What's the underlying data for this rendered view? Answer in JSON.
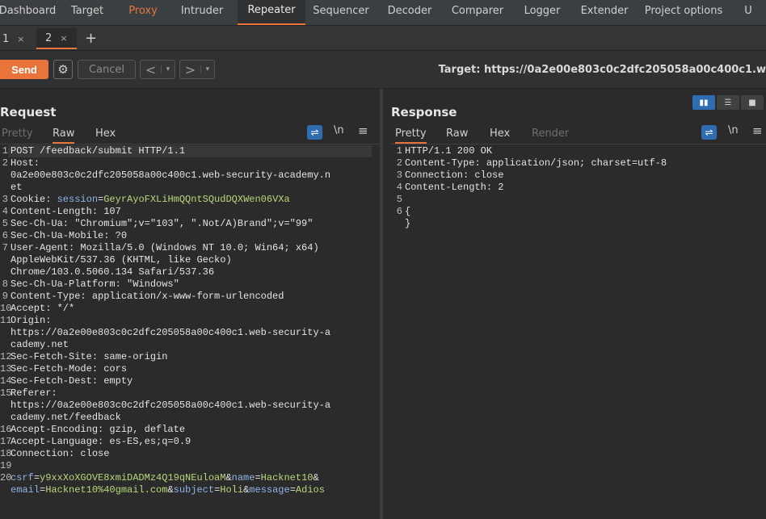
{
  "nav": {
    "tabs": [
      "Dashboard",
      "Target",
      "Proxy",
      "Intruder",
      "Repeater",
      "Sequencer",
      "Decoder",
      "Comparer",
      "Logger",
      "Extender",
      "Project options",
      "U"
    ]
  },
  "subtabs": [
    {
      "label": "1",
      "close": "×"
    },
    {
      "label": "2",
      "close": "×"
    }
  ],
  "add_tab": "+",
  "toolbar": {
    "send_label": "Send",
    "cancel_label": "Cancel",
    "prev_arrow": "<",
    "next_arrow": ">",
    "dropdown": "▾",
    "target": "Target: https://0a2e00e803c0c2dfc205058a00c400c1.w"
  },
  "request": {
    "title": "Request",
    "tabs": [
      "Pretty",
      "Raw",
      "Hex"
    ],
    "active_tab": "Raw",
    "newline_icon": "\\n",
    "lines": [
      {
        "n": "1",
        "parts": [
          [
            "k",
            "POST /feedback/submit HTTP/1.1"
          ]
        ]
      },
      {
        "n": "2",
        "parts": [
          [
            "k",
            "Host: "
          ]
        ]
      },
      {
        "n": "",
        "parts": [
          [
            "k",
            "0a2e00e803c0c2dfc205058a00c400c1.web-security-academy.n"
          ]
        ]
      },
      {
        "n": "",
        "parts": [
          [
            "k",
            "et"
          ]
        ]
      },
      {
        "n": "3",
        "parts": [
          [
            "k",
            "Cookie: "
          ],
          [
            "cv",
            "session"
          ],
          [
            "k",
            "="
          ],
          [
            "gv",
            "GeyrAyoFXLiHmQQntSQudDQXWen06VXa"
          ]
        ]
      },
      {
        "n": "4",
        "parts": [
          [
            "k",
            "Content-Length: 107"
          ]
        ]
      },
      {
        "n": "5",
        "parts": [
          [
            "k",
            "Sec-Ch-Ua: \"Chromium\";v=\"103\", \".Not/A)Brand\";v=\"99\""
          ]
        ]
      },
      {
        "n": "6",
        "parts": [
          [
            "k",
            "Sec-Ch-Ua-Mobile: ?0"
          ]
        ]
      },
      {
        "n": "7",
        "parts": [
          [
            "k",
            "User-Agent: Mozilla/5.0 (Windows NT 10.0; Win64; x64)"
          ]
        ]
      },
      {
        "n": "",
        "parts": [
          [
            "k",
            "AppleWebKit/537.36 (KHTML, like Gecko)"
          ]
        ]
      },
      {
        "n": "",
        "parts": [
          [
            "k",
            "Chrome/103.0.5060.134 Safari/537.36"
          ]
        ]
      },
      {
        "n": "8",
        "parts": [
          [
            "k",
            "Sec-Ch-Ua-Platform: \"Windows\""
          ]
        ]
      },
      {
        "n": "9",
        "parts": [
          [
            "k",
            "Content-Type: application/x-www-form-urlencoded"
          ]
        ]
      },
      {
        "n": "10",
        "parts": [
          [
            "k",
            "Accept: */*"
          ]
        ]
      },
      {
        "n": "11",
        "parts": [
          [
            "k",
            "Origin: "
          ]
        ]
      },
      {
        "n": "",
        "parts": [
          [
            "k",
            "https://0a2e00e803c0c2dfc205058a00c400c1.web-security-a"
          ]
        ]
      },
      {
        "n": "",
        "parts": [
          [
            "k",
            "cademy.net"
          ]
        ]
      },
      {
        "n": "12",
        "parts": [
          [
            "k",
            "Sec-Fetch-Site: same-origin"
          ]
        ]
      },
      {
        "n": "13",
        "parts": [
          [
            "k",
            "Sec-Fetch-Mode: cors"
          ]
        ]
      },
      {
        "n": "14",
        "parts": [
          [
            "k",
            "Sec-Fetch-Dest: empty"
          ]
        ]
      },
      {
        "n": "15",
        "parts": [
          [
            "k",
            "Referer: "
          ]
        ]
      },
      {
        "n": "",
        "parts": [
          [
            "k",
            "https://0a2e00e803c0c2dfc205058a00c400c1.web-security-a"
          ]
        ]
      },
      {
        "n": "",
        "parts": [
          [
            "k",
            "cademy.net/feedback"
          ]
        ]
      },
      {
        "n": "16",
        "parts": [
          [
            "k",
            "Accept-Encoding: gzip, deflate"
          ]
        ]
      },
      {
        "n": "17",
        "parts": [
          [
            "k",
            "Accept-Language: es-ES,es;q=0.9"
          ]
        ]
      },
      {
        "n": "18",
        "parts": [
          [
            "k",
            "Connection: close"
          ]
        ]
      },
      {
        "n": "19",
        "parts": [
          [
            "k",
            ""
          ]
        ]
      },
      {
        "n": "20",
        "parts": [
          [
            "cv",
            "csrf"
          ],
          [
            "k",
            "="
          ],
          [
            "gv",
            "y9xxXoXGOVE8xmiDADMz4Q19qNEuloaM"
          ],
          [
            "k",
            "&"
          ],
          [
            "cv",
            "name"
          ],
          [
            "k",
            "="
          ],
          [
            "gv",
            "Hacknet10"
          ],
          [
            "k",
            "&"
          ]
        ]
      },
      {
        "n": "",
        "parts": [
          [
            "cv",
            "email"
          ],
          [
            "k",
            "="
          ],
          [
            "gv",
            "Hacknet10%40gmail.com"
          ],
          [
            "k",
            "&"
          ],
          [
            "cv",
            "subject"
          ],
          [
            "k",
            "="
          ],
          [
            "gv",
            "Holi"
          ],
          [
            "k",
            "&"
          ],
          [
            "cv",
            "message"
          ],
          [
            "k",
            "="
          ],
          [
            "gv",
            "Adios"
          ]
        ]
      }
    ]
  },
  "response": {
    "title": "Response",
    "tabs": [
      "Pretty",
      "Raw",
      "Hex",
      "Render"
    ],
    "active_tab": "Pretty",
    "newline_icon": "\\n",
    "lines": [
      {
        "n": "1",
        "parts": [
          [
            "k",
            "HTTP/1.1 200 OK"
          ]
        ]
      },
      {
        "n": "2",
        "parts": [
          [
            "k",
            "Content-Type: application/json; charset=utf-8"
          ]
        ]
      },
      {
        "n": "3",
        "parts": [
          [
            "k",
            "Connection: close"
          ]
        ]
      },
      {
        "n": "4",
        "parts": [
          [
            "k",
            "Content-Length: 2"
          ]
        ]
      },
      {
        "n": "5",
        "parts": [
          [
            "k",
            ""
          ]
        ]
      },
      {
        "n": "6",
        "parts": [
          [
            "k",
            "{"
          ]
        ]
      },
      {
        "n": "",
        "parts": [
          [
            "k",
            "}"
          ]
        ]
      }
    ]
  },
  "colors": {
    "accent": "#e8743b",
    "blue": "#2f6db3",
    "param_name": "#8fb4e8",
    "param_value": "#b8d77a"
  }
}
